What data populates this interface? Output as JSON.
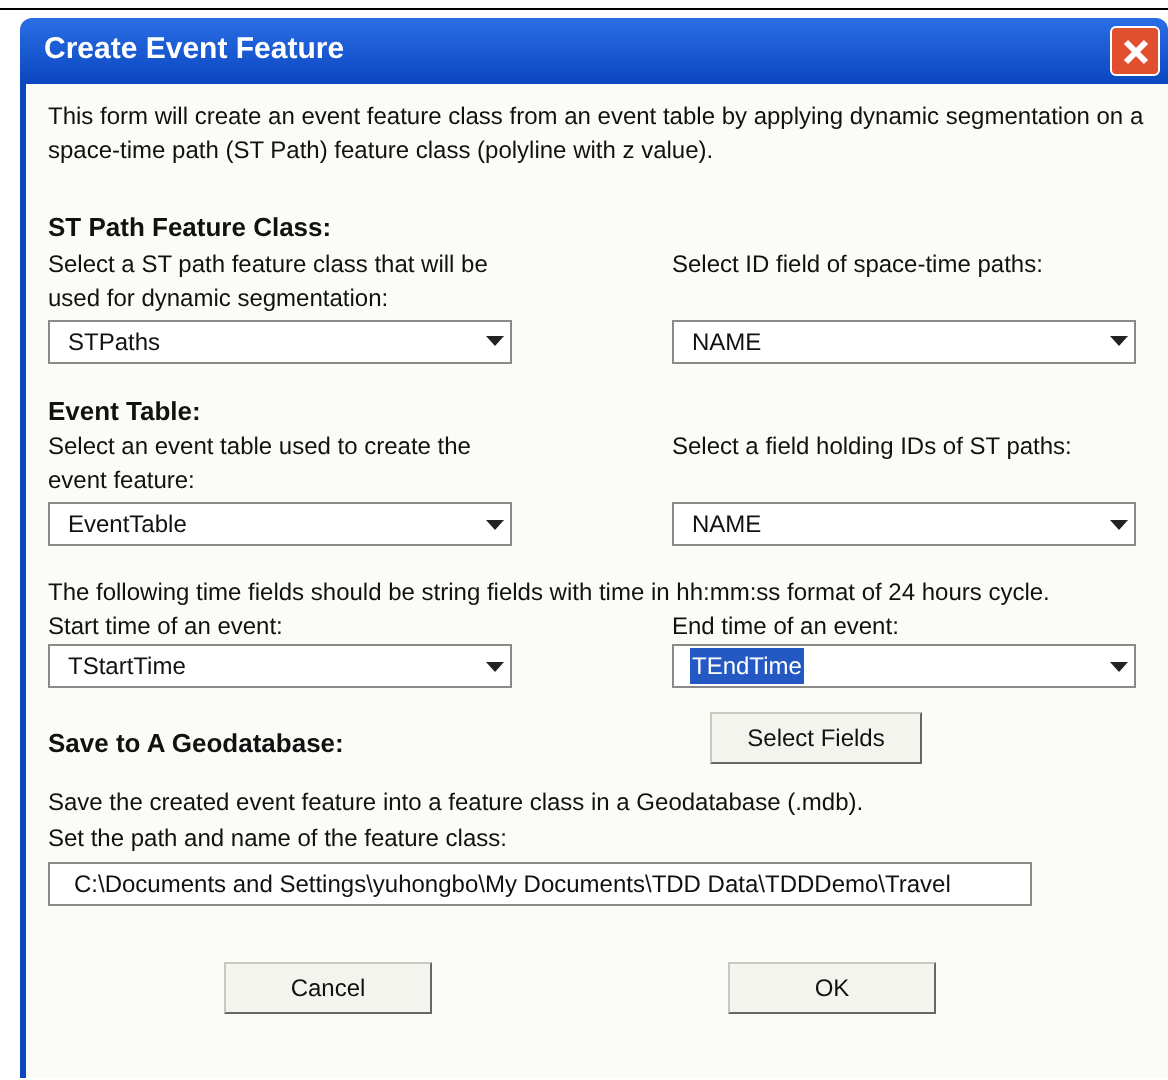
{
  "window": {
    "title": "Create Event Feature"
  },
  "intro": "This form will create an event feature class from an event table by applying dynamic segmentation on a space-time path (ST Path) feature class (polyline with z value).",
  "st_path": {
    "heading": "ST Path Feature Class:",
    "left": {
      "label": "Select a ST path feature class that will be used for dynamic segmentation:",
      "value": "STPaths",
      "highlighted": false
    },
    "right": {
      "label": "Select ID field of space-time paths:",
      "value": "NAME",
      "highlighted": false
    }
  },
  "event_table": {
    "heading": "Event Table:",
    "left": {
      "label": "Select an event table used to create the event feature:",
      "value": "EventTable",
      "highlighted": false
    },
    "right": {
      "label": "Select a field holding IDs of ST paths:",
      "value": "NAME",
      "highlighted": false
    }
  },
  "time_note": "The following time fields should be string fields with time in hh:mm:ss format of 24 hours cycle.",
  "time": {
    "left": {
      "label": "Start time of an event:",
      "value": "TStartTime",
      "highlighted": false
    },
    "right": {
      "label": "End time of an event:",
      "value": "TEndTime",
      "highlighted": true
    }
  },
  "save": {
    "heading": "Save to A Geodatabase:",
    "button": "Select Fields",
    "note_1": "Save the created event feature into a feature class in a Geodatabase (.mdb).",
    "note_2": "Set the path and name of the feature class:",
    "path": "C:\\Documents and Settings\\yuhongbo\\My Documents\\TDD Data\\TDDDemo\\Travel"
  },
  "buttons": [
    "Cancel",
    "OK"
  ]
}
